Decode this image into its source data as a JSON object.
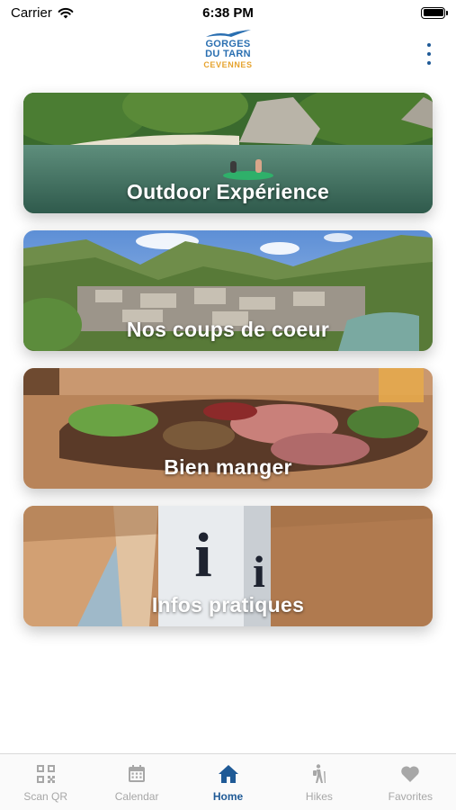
{
  "status_bar": {
    "carrier": "Carrier",
    "time": "6:38 PM"
  },
  "header": {
    "logo_line1": "GORGES",
    "logo_line2": "DU TARN",
    "logo_line3": "CEVENNES"
  },
  "cards": [
    {
      "title": "Outdoor Expérience"
    },
    {
      "title": "Nos coups de coeur"
    },
    {
      "title": "Bien manger"
    },
    {
      "title": "Infos pratiques"
    }
  ],
  "tabs": [
    {
      "label": "Scan QR",
      "icon": "qr-code-icon"
    },
    {
      "label": "Calendar",
      "icon": "calendar-icon"
    },
    {
      "label": "Home",
      "icon": "home-icon",
      "active": true
    },
    {
      "label": "Hikes",
      "icon": "hiker-icon"
    },
    {
      "label": "Favorites",
      "icon": "heart-icon"
    }
  ],
  "colors": {
    "accent": "#1f5a96",
    "tab_inactive": "#a7a7a7",
    "logo_blue": "#2a6fb1",
    "logo_orange": "#e6a32e"
  }
}
